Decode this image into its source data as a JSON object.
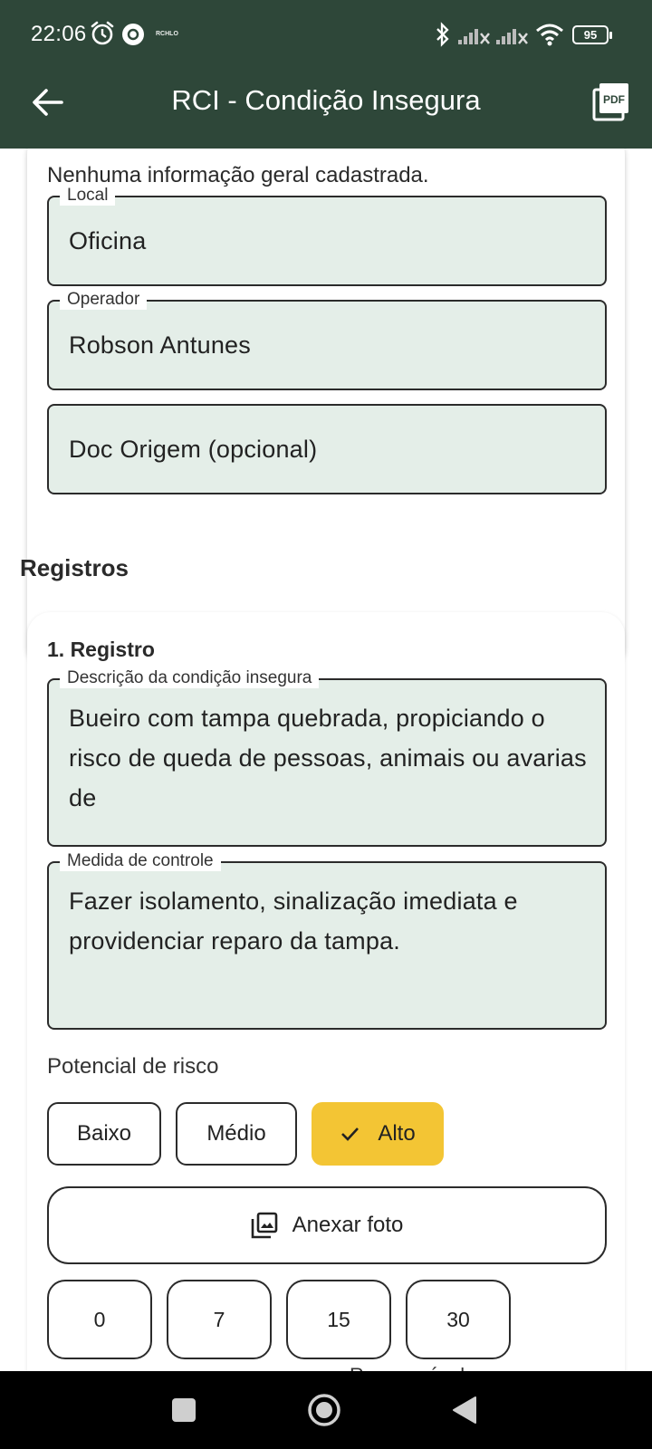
{
  "status_bar": {
    "time": "22:06",
    "notification_text": "RCHLO",
    "battery": "95"
  },
  "app_bar": {
    "title": "RCI - Condição Insegura",
    "pdf_label": "PDF"
  },
  "general_info": {
    "empty_message": "Nenhuma informação geral cadastrada.",
    "local": {
      "label": "Local",
      "value": "Oficina"
    },
    "operator": {
      "label": "Operador",
      "value": "Robson Antunes"
    },
    "doc_origin": {
      "placeholder": "Doc Origem (opcional)"
    }
  },
  "records": {
    "section_title": "Registros",
    "items": [
      {
        "title": "1. Registro",
        "description": {
          "label": "Descrição da condição insegura",
          "value": "Bueiro com tampa quebrada, propiciando o risco de queda de pessoas, animais ou avarias de"
        },
        "control": {
          "label": "Medida de controle",
          "value": "Fazer isolamento, sinalização imediata e providenciar reparo da tampa."
        },
        "risk": {
          "label": "Potencial de risco",
          "options": [
            "Baixo",
            "Médio",
            "Alto"
          ],
          "selected": "Alto"
        },
        "attach_label": "Anexar foto",
        "day_options": [
          "0",
          "7",
          "15",
          "30"
        ],
        "cut_off_label": "Responsável"
      }
    ]
  },
  "colors": {
    "app_bar": "#2e4739",
    "field_fill": "#e4eee8",
    "selected_chip": "#f3c534"
  }
}
